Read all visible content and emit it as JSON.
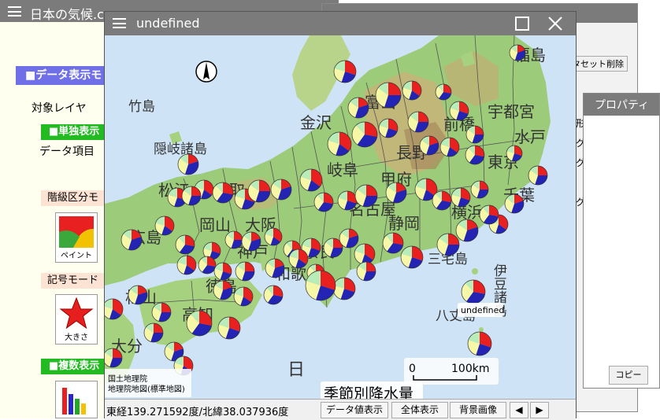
{
  "back_window": {
    "title": "日本の気候.c",
    "panel_header": "■データ表示モ",
    "target_layer_label": "対象レイヤ",
    "single_display_header": "■単独表示",
    "data_item_label": "データ項目",
    "class_mode_label": "階級区分モ",
    "paint_caption": "ペイント",
    "symbol_mode_label": "記号モード",
    "size_caption": "大きさ",
    "multi_display_header": "■複数表示"
  },
  "mid_window": {
    "delete_dataset_label": "タセット削除",
    "side_chars": [
      "形",
      "グ",
      "グ",
      "グ"
    ]
  },
  "prop_window": {
    "title": "プロパティ",
    "copy_label": "コピー"
  },
  "map_window": {
    "title": "undefined",
    "marker_label": "undefined",
    "legend_title": "季節別降水量",
    "attribution_line1": "国土地理院",
    "attribution_line2": "地理院地図(標準地図)",
    "scale_zero": "0",
    "scale_distance": "100km",
    "coordinates": "東経139.271592度/北緯38.037936度",
    "btn_data_display": "データ値表示",
    "btn_full_display": "全体表示",
    "btn_background": "背景画像",
    "pie_colors": [
      "#e82020",
      "#2323b4",
      "#f7f7a8",
      "#b8ecb8"
    ],
    "place_labels": {
      "takeshima": "竹島",
      "oki": "隠岐諸島",
      "matsue": "松江",
      "tottori": "鳥取",
      "okayama": "岡山",
      "osaka": "大阪",
      "hiroshima": "広島",
      "kobe": "神戸",
      "matsuyama": "松山",
      "tokushima": "徳島",
      "kochi": "高知",
      "oita": "大分",
      "wakayama": "和歌",
      "nara": "奈良",
      "gifu": "岐阜",
      "nagoya": "名古屋",
      "kanazawa": "金沢",
      "toyama": "富山",
      "nagano": "長野",
      "maebashi": "前橋",
      "utsunomiya": "宇都宮",
      "mito": "水戸",
      "tokyo": "東京",
      "chiba": "千葉",
      "yokohama": "横浜",
      "kofu": "甲府",
      "shizuoka": "静岡",
      "fukushima": "福島",
      "miyake": "三宅島",
      "hachijo": "八丈島",
      "izu": "伊豆諸島",
      "nihon_char": "日"
    }
  }
}
